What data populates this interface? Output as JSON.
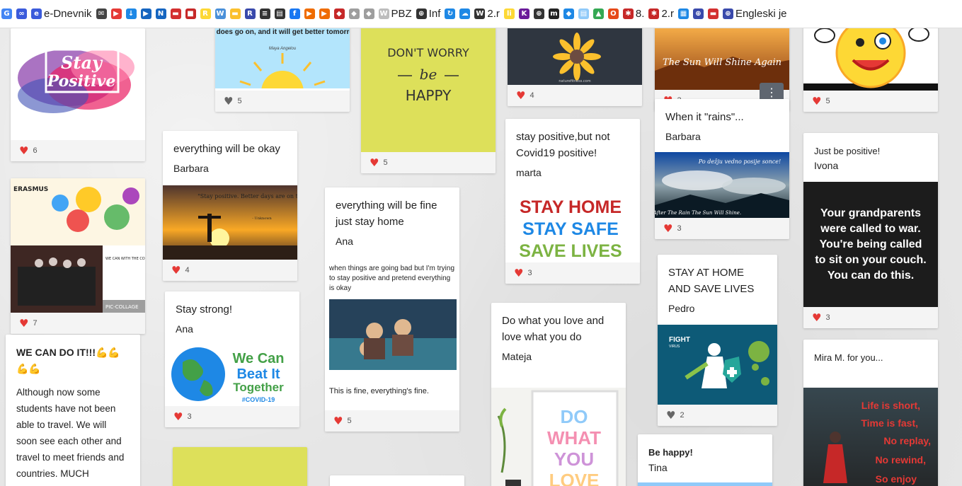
{
  "bookmarks": [
    {
      "icon": "google-icon",
      "label": "",
      "color": "#4285f4"
    },
    {
      "icon": "link-icon",
      "label": "",
      "color": "#3b5bdb"
    },
    {
      "icon": "ednevnik-icon",
      "label": "e-Dnevnik",
      "color": "#3b5bdb"
    },
    {
      "icon": "mail-icon",
      "label": "",
      "color": "#444"
    },
    {
      "icon": "youtube-icon",
      "label": "",
      "color": "#e53935"
    },
    {
      "icon": "download-icon",
      "label": "",
      "color": "#1e88e5"
    },
    {
      "icon": "video-icon",
      "label": "",
      "color": "#1565c0"
    },
    {
      "icon": "news-icon",
      "label": "",
      "color": "#1565c0"
    },
    {
      "icon": "flag-icon",
      "label": "",
      "color": "#d32f2f"
    },
    {
      "icon": "gift-icon",
      "label": "",
      "color": "#c62828"
    },
    {
      "icon": "ry-icon",
      "label": "",
      "color": "#fdd835"
    },
    {
      "icon": "web-icon",
      "label": "",
      "color": "#4a90d9"
    },
    {
      "icon": "book-icon",
      "label": "",
      "color": "#fbc02d"
    },
    {
      "icon": "r-icon",
      "label": "",
      "color": "#3949ab"
    },
    {
      "icon": "doc-icon",
      "label": "",
      "color": "#333"
    },
    {
      "icon": "print-icon",
      "label": "",
      "color": "#333"
    },
    {
      "icon": "facebook-icon",
      "label": "",
      "color": "#1877f2"
    },
    {
      "icon": "play-icon",
      "label": "",
      "color": "#ef6c00"
    },
    {
      "icon": "play-icon-2",
      "label": "",
      "color": "#ef6c00"
    },
    {
      "icon": "shield-icon",
      "label": "",
      "color": "#c62828"
    },
    {
      "icon": "shield-icon-2",
      "label": "",
      "color": "#9e9e9e"
    },
    {
      "icon": "shield-icon-3",
      "label": "",
      "color": "#9e9e9e"
    },
    {
      "icon": "pbz-icon",
      "label": "PBZ",
      "color": "#bdbdbd"
    },
    {
      "icon": "globe-icon",
      "label": "Inf",
      "color": "#333"
    },
    {
      "icon": "sync-icon",
      "label": "",
      "color": "#1e88e5"
    },
    {
      "icon": "cloud-icon",
      "label": "",
      "color": "#1e88e5"
    },
    {
      "icon": "w-icon",
      "label": "2.r",
      "color": "#333"
    },
    {
      "icon": "li-icon",
      "label": "",
      "color": "#fdd835"
    },
    {
      "icon": "k-icon",
      "label": "",
      "color": "#6a1b9a"
    },
    {
      "icon": "globe-icon-2",
      "label": "",
      "color": "#333"
    },
    {
      "icon": "m-icon",
      "label": "",
      "color": "#222"
    },
    {
      "icon": "dropbox-icon",
      "label": "",
      "color": "#1e88e5"
    },
    {
      "icon": "file-icon",
      "label": "",
      "color": "#90caf9"
    },
    {
      "icon": "drive-icon",
      "label": "",
      "color": "#34a853"
    },
    {
      "icon": "office-icon",
      "label": "",
      "color": "#e64a19"
    },
    {
      "icon": "eight-icon",
      "label": "8.",
      "color": "#c62828"
    },
    {
      "icon": "two-r-icon",
      "label": "2.r",
      "color": "#c62828"
    },
    {
      "icon": "puzzle-icon",
      "label": "",
      "color": "#1e88e5"
    },
    {
      "icon": "globe-icon-3",
      "label": "",
      "color": "#3949ab"
    },
    {
      "icon": "flag-icon-2",
      "label": "",
      "color": "#d32f2f"
    },
    {
      "icon": "globe-icon-4",
      "label": "Engleski je",
      "color": "#3949ab"
    }
  ],
  "cards": {
    "stay_positive_image": {
      "likes": "6"
    },
    "life_goes_on": {
      "quote": "life does go on, and it will get better tomorrow.",
      "attribution": "Maya Angelou",
      "likes": "5"
    },
    "dont_worry": {
      "line1": "DON'T WORRY",
      "line2": "be",
      "line3": "HAPPY",
      "likes": "5"
    },
    "sunflower": {
      "url": "naturefitness.com",
      "likes": "4"
    },
    "sun_will_shine": {
      "caption": "The Sun Will Shine Again",
      "likes": "3"
    },
    "smiley": {
      "likes": "5"
    },
    "everything_okay": {
      "title": "everything will be okay",
      "author": "Barbara",
      "quote": "\"Stay positive. Better days are on their way.\"",
      "attribution": "- Unknown",
      "likes": "4"
    },
    "stay_positive_covid": {
      "title": "stay positive,but not Covid19 positive!",
      "author": "marta",
      "line1": "STAY HOME",
      "line2": "STAY SAFE",
      "line3": "SAVE LIVES",
      "likes": "3"
    },
    "when_it_rains": {
      "title": "When it \"rains\"...",
      "author": "Barbara",
      "caption_top": "Po dežju vedno posije sonce!",
      "caption_bottom": "After The Rain The Sun Will Shine.",
      "likes": "3"
    },
    "just_be_positive": {
      "title": "Just be positive!",
      "author": "Ivona",
      "quote": "Your grandparents were called to war. You're being called to sit on your couch. You can do this.",
      "likes": "3"
    },
    "erasmus": {
      "label": "ERASMUS",
      "footer": "PIC-COLLAGE",
      "note": "WE CAN WITH THE CORONAVIRUS",
      "likes": "7"
    },
    "everything_fine": {
      "title": "everything will be fine just stay home",
      "author": "Ana",
      "caption": "when things are going bad but I'm trying to stay positive and pretend everything is okay",
      "sub": "This is fine, everything's fine.",
      "likes": "5"
    },
    "stay_strong": {
      "title": "Stay strong!",
      "author": "Ana",
      "line1": "We Can",
      "line2": "Beat It",
      "line3": "Together",
      "hashtag": "#COVID-19",
      "likes": "3"
    },
    "stay_home_save": {
      "title": "STAY AT HOME AND SAVE LIVES",
      "author": "Pedro",
      "fight": "FIGHT",
      "virus": "VIRUS",
      "likes": "2"
    },
    "do_what_you_love": {
      "title": "Do what you love and love what you do",
      "author": "Mateja",
      "art1": "DO",
      "art2": "WHAT",
      "art3": "YOU",
      "art4": "LOVE"
    },
    "we_can_do_it": {
      "title": "WE CAN DO IT!!!💪💪💪💪",
      "body": "Although now some students have not been able to travel. We will soon see each other and travel to meet friends and countries. MUCH ENCOURAGEMENT!!!!!!"
    },
    "be_happy": {
      "title": "Be happy!",
      "author": "Tina"
    },
    "mira": {
      "title": "Mira M. for you...",
      "line1": "Life is short,",
      "line2": "Time is fast,",
      "line3": "No replay,",
      "line4": "No rewind,",
      "line5": "So enjoy"
    }
  },
  "stay_positive_text": {
    "line1": "Stay",
    "line2": "Positive"
  },
  "colors": {
    "heart": "#e53935",
    "heart_grey": "#666666",
    "lime": "#dde05a"
  }
}
